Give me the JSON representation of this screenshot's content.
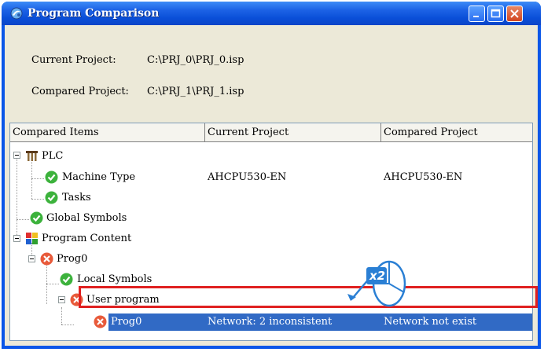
{
  "window": {
    "title": "Program Comparison"
  },
  "info": {
    "current_label": "Current Project:",
    "current_value": "C:\\PRJ_0\\PRJ_0.isp",
    "compared_label": "Compared Project:",
    "compared_value": "C:\\PRJ_1\\PRJ_1.isp"
  },
  "columns": [
    "Compared Items",
    "Current Project",
    "Compared Project"
  ],
  "tree": [
    {
      "label": "PLC",
      "icon": "plc-icon",
      "current": "",
      "compared": ""
    },
    {
      "label": "Machine Type",
      "icon": "check-icon",
      "current": "AHCPU530-EN",
      "compared": "AHCPU530-EN"
    },
    {
      "label": "Tasks",
      "icon": "check-icon",
      "current": "",
      "compared": ""
    },
    {
      "label": "Global Symbols",
      "icon": "check-icon",
      "current": "",
      "compared": ""
    },
    {
      "label": "Program Content",
      "icon": "program-content-icon",
      "current": "",
      "compared": ""
    },
    {
      "label": "Prog0",
      "icon": "error-icon",
      "current": "",
      "compared": ""
    },
    {
      "label": "Local Symbols",
      "icon": "check-icon",
      "current": "",
      "compared": ""
    },
    {
      "label": "User program",
      "icon": "error-icon",
      "current": "",
      "compared": ""
    },
    {
      "label": "Prog0",
      "icon": "error-icon",
      "current": "Network: 2 inconsistent",
      "compared": "Network not exist"
    }
  ],
  "annotation": {
    "badge": "x2",
    "icon": "mouse-icon"
  },
  "colors": {
    "titlebar": "#0a56e8",
    "selection": "#316ac5",
    "highlight_border": "#e02020"
  }
}
